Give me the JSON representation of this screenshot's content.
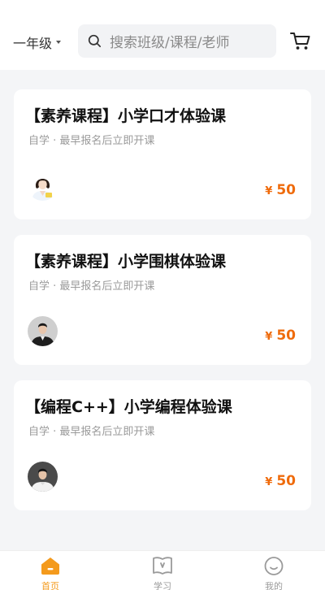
{
  "header": {
    "grade_label": "一年级",
    "search_placeholder": "搜索班级/课程/老师"
  },
  "courses": [
    {
      "title": "【素养课程】小学口才体验课",
      "subtitle": "自学 · 最早报名后立即开课",
      "currency": "¥",
      "price": "50",
      "avatar": "female-teacher-avatar"
    },
    {
      "title": "【素养课程】小学围棋体验课",
      "subtitle": "自学 · 最早报名后立即开课",
      "currency": "¥",
      "price": "50",
      "avatar": "male-teacher-avatar"
    },
    {
      "title": "【编程C++】小学编程体验课",
      "subtitle": "自学 · 最早报名后立即开课",
      "currency": "¥",
      "price": "50",
      "avatar": "male-teacher-avatar"
    }
  ],
  "tabbar": {
    "items": [
      {
        "label": "首页",
        "icon": "home-icon",
        "active": true
      },
      {
        "label": "学习",
        "icon": "book-icon",
        "active": false
      },
      {
        "label": "我的",
        "icon": "profile-icon",
        "active": false
      }
    ]
  },
  "colors": {
    "accent": "#f49a1c",
    "price": "#ef6b0c",
    "background": "#f4f5f7"
  }
}
